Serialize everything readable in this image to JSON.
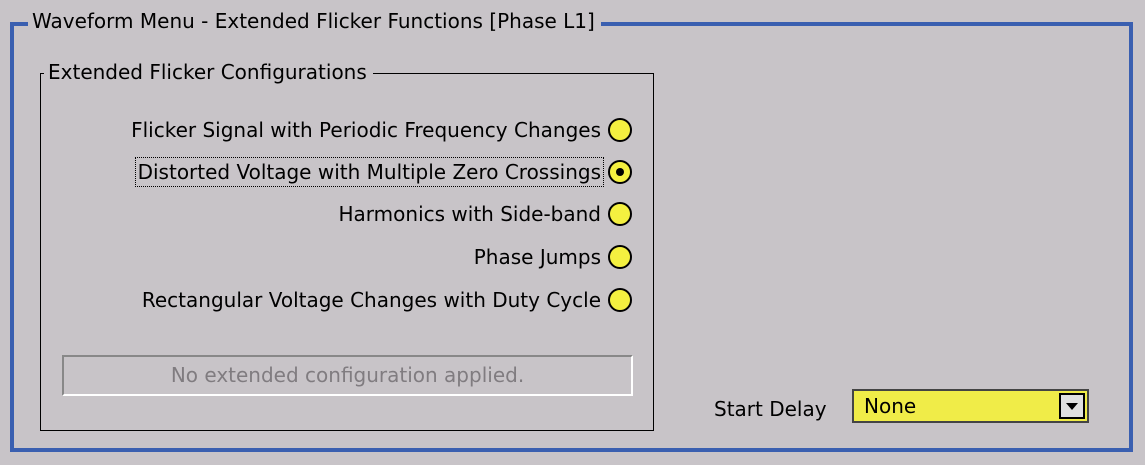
{
  "window": {
    "title": "Waveform Menu - Extended Flicker Functions [Phase L1]"
  },
  "group": {
    "title": "Extended Flicker Configurations",
    "options": [
      {
        "label": "Flicker Signal with Periodic Frequency Changes",
        "selected": false
      },
      {
        "label": "Distorted Voltage with Multiple Zero Crossings",
        "selected": true
      },
      {
        "label": "Harmonics with Side-band",
        "selected": false
      },
      {
        "label": "Phase Jumps",
        "selected": false
      },
      {
        "label": "Rectangular Voltage Changes with Duty Cycle",
        "selected": false
      }
    ],
    "status_text": "No extended configuration applied."
  },
  "start_delay": {
    "label": "Start Delay",
    "value": "None"
  },
  "colors": {
    "frame": "#3a5fb0",
    "background": "#c8c4c8",
    "highlight": "#f0ec48"
  },
  "icons": {
    "dropdown": "chevron-down-icon",
    "radio": "radio-button-icon"
  }
}
